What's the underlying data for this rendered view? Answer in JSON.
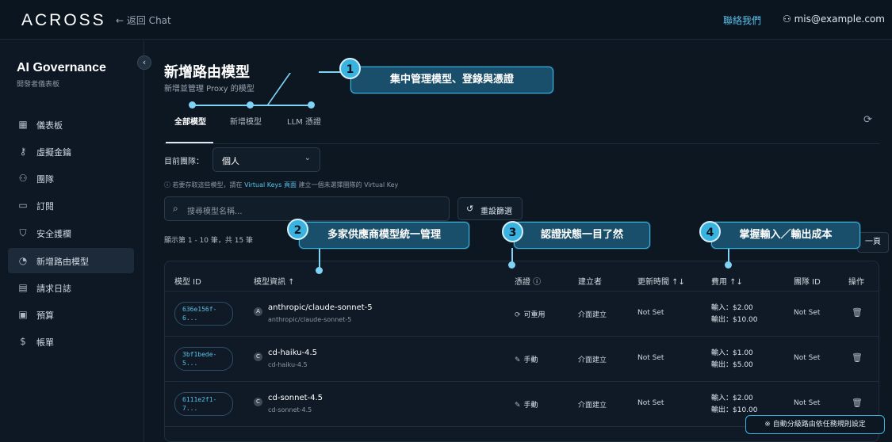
{
  "topbar": {
    "logo": "ACROSS",
    "back": "← 返回 Chat",
    "contact": "聯絡我們",
    "user": "mis@example.com"
  },
  "sidebar": {
    "title": "AI Governance",
    "subtitle": "開發者儀表板",
    "items": [
      {
        "label": "儀表板",
        "icon": "dashboard-icon"
      },
      {
        "label": "虛擬金鑰",
        "icon": "key-icon"
      },
      {
        "label": "團隊",
        "icon": "team-icon"
      },
      {
        "label": "訂閱",
        "icon": "card-icon"
      },
      {
        "label": "安全護欄",
        "icon": "shield-icon"
      },
      {
        "label": "新增路由模型",
        "icon": "gauge-icon"
      },
      {
        "label": "請求日誌",
        "icon": "doc-icon"
      },
      {
        "label": "預算",
        "icon": "wallet-icon"
      },
      {
        "label": "帳單",
        "icon": "invoice-icon"
      }
    ]
  },
  "main": {
    "title": "新增路由模型",
    "subtitle": "新增並管理 Proxy 的模型",
    "tabs": [
      "全部模型",
      "新增模型",
      "LLM 憑證"
    ],
    "team_label": "目前團隊：",
    "team_value": "個人",
    "hint_pre": "ⓘ 若要存取這些模型，請在",
    "hint_link": "Virtual Keys 頁面",
    "hint_post": "建立一個未選擇團隊的 Virtual Key",
    "search_placeholder": "搜尋模型名稱...",
    "reset_label": "重設篩選",
    "count_text": "顯示第 1 - 10 筆，共 15 筆",
    "next_label": "一頁"
  },
  "table": {
    "headers": [
      "模型 ID",
      "模型資訊 ↑",
      "憑證 ⓘ",
      "建立者",
      "更新時間 ↑↓",
      "費用 ↑↓",
      "團隊 ID",
      "操作"
    ],
    "rows": [
      {
        "id1": "636e156f-",
        "id2": "6...",
        "prov": "A",
        "name": "anthropic/claude-sonnet-5",
        "sub": "anthropic/claude-sonnet-5",
        "cred_icon": "⟳",
        "cred": "可重用",
        "creator": "介面建立",
        "updated": "Not Set",
        "cost_in": "輸入：$2.00",
        "cost_out": "輸出：$10.00",
        "team": "Not Set"
      },
      {
        "id1": "3bf1bede-",
        "id2": "5...",
        "prov": "C",
        "name": "cd-haiku-4.5",
        "sub": "cd-haiku-4.5",
        "cred_icon": "✎",
        "cred": "手動",
        "creator": "介面建立",
        "updated": "Not Set",
        "cost_in": "輸入：$1.00",
        "cost_out": "輸出：$5.00",
        "team": "Not Set"
      },
      {
        "id1": "6111e2f1-",
        "id2": "7...",
        "prov": "C",
        "name": "cd-sonnet-4.5",
        "sub": "cd-sonnet-4.5",
        "cred_icon": "✎",
        "cred": "手動",
        "creator": "介面建立",
        "updated": "Not Set",
        "cost_in": "輸入：$2.00",
        "cost_out": "輸出：$10.00",
        "team": "Not Set"
      }
    ]
  },
  "annotations": [
    {
      "num": "1",
      "text": "集中管理模型、登錄與憑證"
    },
    {
      "num": "2",
      "text": "多家供應商模型統一管理"
    },
    {
      "num": "3",
      "text": "認證狀態一目了然"
    },
    {
      "num": "4",
      "text": "掌握輸入／輸出成本"
    }
  ],
  "note": "※ 自動分級路由依任務規則設定",
  "colors": {
    "accent": "#3ab3e0",
    "link": "#58c2ea",
    "bg": "#0d1722"
  }
}
